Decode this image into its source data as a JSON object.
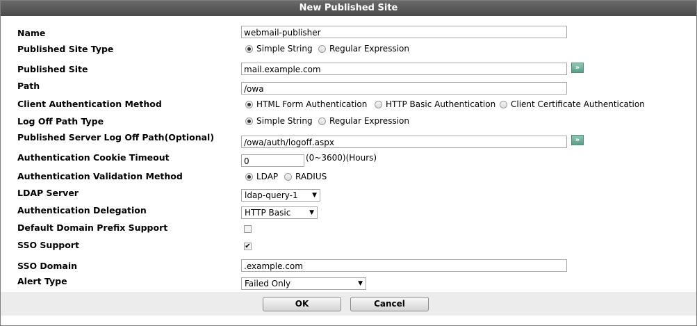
{
  "dialog": {
    "title": "New Published Site"
  },
  "fields": {
    "name": {
      "label": "Name",
      "value": "webmail-publisher"
    },
    "published_site_type": {
      "label": "Published Site Type",
      "options": [
        "Simple String",
        "Regular Expression"
      ],
      "selected": "Simple String"
    },
    "published_site": {
      "label": "Published Site",
      "value": "mail.example.com"
    },
    "path": {
      "label": "Path",
      "value": "/owa"
    },
    "client_auth_method": {
      "label": "Client Authentication Method",
      "options": [
        "HTML Form Authentication",
        "HTTP Basic Authentication",
        "Client Certificate Authentication"
      ],
      "selected": "HTML Form Authentication"
    },
    "log_off_path_type": {
      "label": "Log Off Path Type",
      "options": [
        "Simple String",
        "Regular Expression"
      ],
      "selected": "Simple String"
    },
    "log_off_path": {
      "label": "Published Server Log Off Path(Optional)",
      "value": "/owa/auth/logoff.aspx"
    },
    "cookie_timeout": {
      "label": "Authentication Cookie Timeout",
      "value": "0",
      "hint": "(0~3600)(Hours)"
    },
    "validation_method": {
      "label": "Authentication Validation Method",
      "options": [
        "LDAP",
        "RADIUS"
      ],
      "selected": "LDAP"
    },
    "ldap_server": {
      "label": "LDAP Server",
      "value": "ldap-query-1"
    },
    "auth_delegation": {
      "label": "Authentication Delegation",
      "value": "HTTP Basic"
    },
    "default_domain_prefix": {
      "label": "Default Domain Prefix Support",
      "checked": false
    },
    "sso_support": {
      "label": "SSO Support",
      "checked": true
    },
    "sso_domain": {
      "label": "SSO Domain",
      "value": ".example.com"
    },
    "alert_type": {
      "label": "Alert Type",
      "value": "Failed Only"
    }
  },
  "icons": {
    "add_arrow": "double-chevron-right-icon",
    "dropdown": "chevron-down-icon",
    "check": "checkmark-icon"
  },
  "buttons": {
    "ok": "OK",
    "cancel": "Cancel"
  }
}
